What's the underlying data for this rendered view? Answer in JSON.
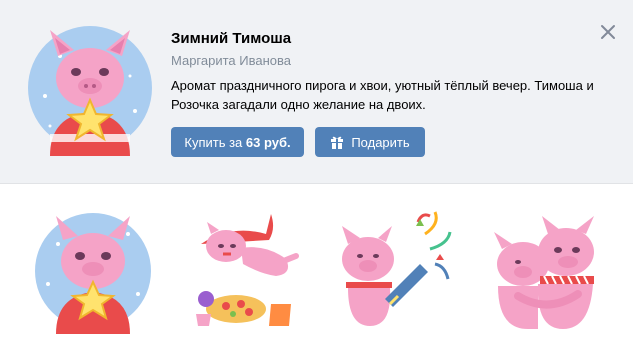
{
  "pack": {
    "title": "Зимний Тимоша",
    "author": "Маргарита Иванова",
    "description": "Аромат праздничного пирога и хвои, уютный тёплый вечер. Тимоша и Розочка загадали одно желание на двоих."
  },
  "buttons": {
    "buy_prefix": "Купить за ",
    "buy_price": "63 руб.",
    "gift_label": "Подарить"
  },
  "icons": {
    "close": "close-icon",
    "gift": "gift-icon"
  },
  "stickers": [
    {
      "name": "pig-with-star"
    },
    {
      "name": "pig-flying-with-pizza"
    },
    {
      "name": "pig-with-party-popper"
    },
    {
      "name": "pigs-hugging"
    }
  ],
  "colors": {
    "header_bg": "#f0f2f5",
    "button_bg": "#5181b8",
    "author_text": "#818c99",
    "pig_pink": "#f5a3c7",
    "circle_blue": "#aacdf0"
  }
}
